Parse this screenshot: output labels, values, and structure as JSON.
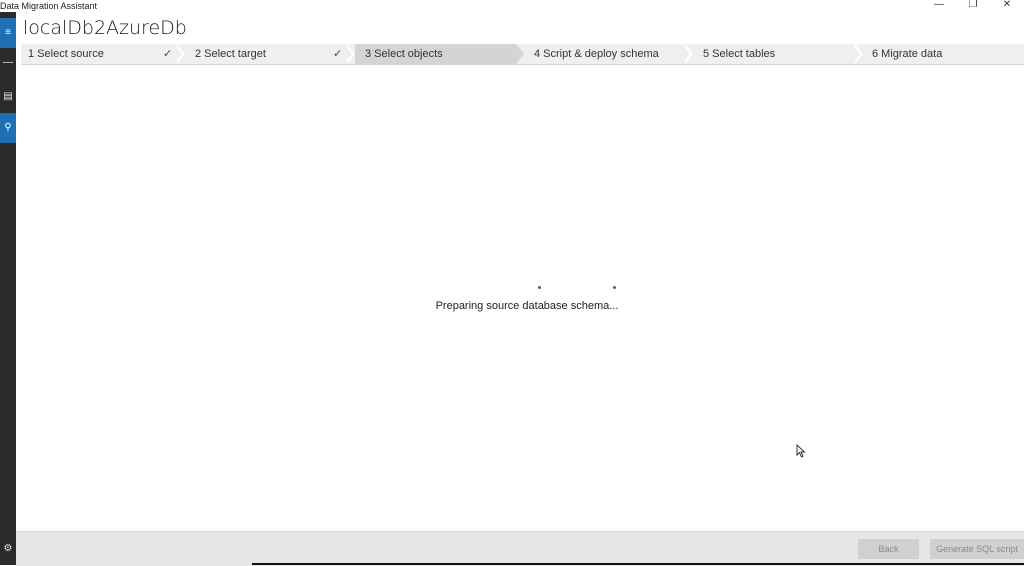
{
  "app": {
    "title": "Data Migration Assistant"
  },
  "window_controls": {
    "minimize": "—",
    "restore": "❐",
    "close": "✕"
  },
  "sidebar": {
    "menu_icon": "≡",
    "items": [
      {
        "icon": "—"
      },
      {
        "icon": "▤"
      },
      {
        "icon": "⚲"
      }
    ],
    "settings_icon": "⚙"
  },
  "project": {
    "name": "localDb2AzureDb"
  },
  "steps": [
    {
      "label": "1  Select source",
      "check": "✓"
    },
    {
      "label": "2  Select target",
      "check": "✓"
    },
    {
      "label": "3  Select objects"
    },
    {
      "label": "4  Script & deploy schema"
    },
    {
      "label": "5  Select tables"
    },
    {
      "label": "6  Migrate data"
    }
  ],
  "status": {
    "message": "Preparing source database schema..."
  },
  "footer": {
    "back": "Back",
    "generate": "Generate SQL script"
  }
}
